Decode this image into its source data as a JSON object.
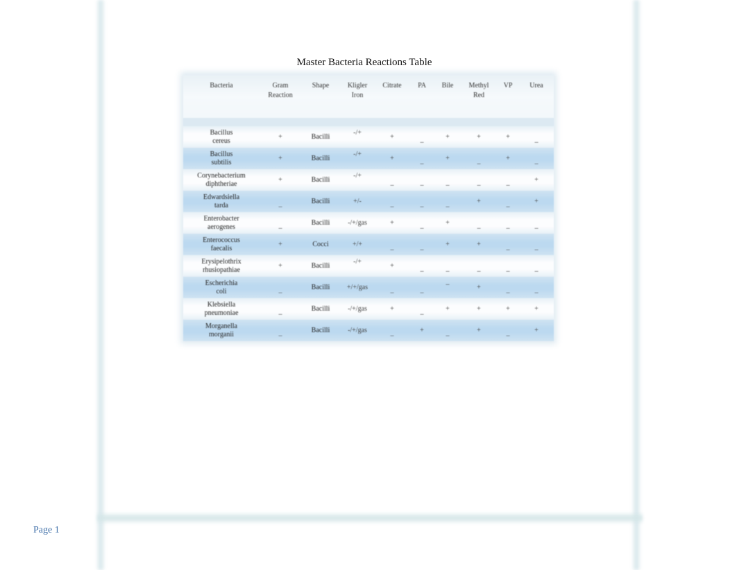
{
  "document": {
    "title": "Master Bacteria Reactions Table",
    "footer": {
      "page_label": "Page 1"
    }
  },
  "table": {
    "headers": [
      [
        "Bacteria"
      ],
      [
        "Gram",
        "Reaction"
      ],
      [
        "Shape"
      ],
      [
        "Kligler",
        "Iron"
      ],
      [
        "Citrate"
      ],
      [
        "PA"
      ],
      [
        "Bile"
      ],
      [
        "Methyl",
        "Red"
      ],
      [
        "VP"
      ],
      [
        "Urea"
      ]
    ],
    "rows": [
      {
        "name": [
          "Bacillus",
          "cereus"
        ],
        "gram": "+",
        "shape": "Bacilli",
        "kligler": "-/+",
        "citrate": "+",
        "pa": "_",
        "bile": "+",
        "methyl_red": "+",
        "vp": "+",
        "urea": "_"
      },
      {
        "name": [
          "Bacillus",
          "subtilis"
        ],
        "gram": "+",
        "shape": "Bacilli",
        "kligler": "-/+",
        "citrate": "+",
        "pa": "_",
        "bile": "+",
        "methyl_red": "_",
        "vp": "+",
        "urea": "_"
      },
      {
        "name": [
          "Corynebacterium",
          "diphtheriae"
        ],
        "gram": "+",
        "shape": "Bacilli",
        "kligler": "-/+",
        "citrate": "_",
        "pa": "_",
        "bile": "_",
        "methyl_red": "_",
        "vp": "_",
        "urea": "+"
      },
      {
        "name": [
          "Edwardsiella",
          "tarda"
        ],
        "gram": "_",
        "shape": "Bacilli",
        "kligler": "+/-",
        "citrate": "_",
        "pa": "_",
        "bile": "_",
        "methyl_red": "+",
        "vp": "_",
        "urea": "+"
      },
      {
        "name": [
          "Enterobacter",
          "aerogenes"
        ],
        "gram": "_",
        "shape": "Bacilli",
        "kligler": "-/+/gas",
        "citrate": "+",
        "pa": "_",
        "bile": "+",
        "methyl_red": "_",
        "vp": "_",
        "urea": "_"
      },
      {
        "name": [
          "Enterococcus",
          "faecalis"
        ],
        "gram": "+",
        "shape": "Cocci",
        "kligler": "+/+",
        "citrate": "_",
        "pa": "_",
        "bile": "+",
        "methyl_red": "+",
        "vp": "_",
        "urea": "_"
      },
      {
        "name": [
          "Erysipelothrix",
          "rhusiopathiae"
        ],
        "gram": "+",
        "shape": "Bacilli",
        "kligler": "-/+",
        "citrate": "+",
        "pa": "_",
        "bile": "_",
        "methyl_red": "_",
        "vp": "_",
        "urea": "_"
      },
      {
        "name": [
          "Escherichia",
          "coli"
        ],
        "gram": "_",
        "shape": "Bacilli",
        "kligler": "+/+/gas",
        "citrate": "_",
        "pa": "_",
        "bile": "–",
        "methyl_red": "+",
        "vp": "_",
        "urea": "_"
      },
      {
        "name": [
          "Klebsiella",
          "pneumoniae"
        ],
        "gram": "_",
        "shape": "Bacilli",
        "kligler": "-/+/gas",
        "citrate": "+",
        "pa": "_",
        "bile": "+",
        "methyl_red": "+",
        "vp": "+",
        "urea": "+"
      },
      {
        "name": [
          "Morganella",
          "morganii"
        ],
        "gram": "_",
        "shape": "Bacilli",
        "kligler": "-/+/gas",
        "citrate": "_",
        "pa": "+",
        "bile": "_",
        "methyl_red": "+",
        "vp": "_",
        "urea": "+"
      }
    ]
  }
}
